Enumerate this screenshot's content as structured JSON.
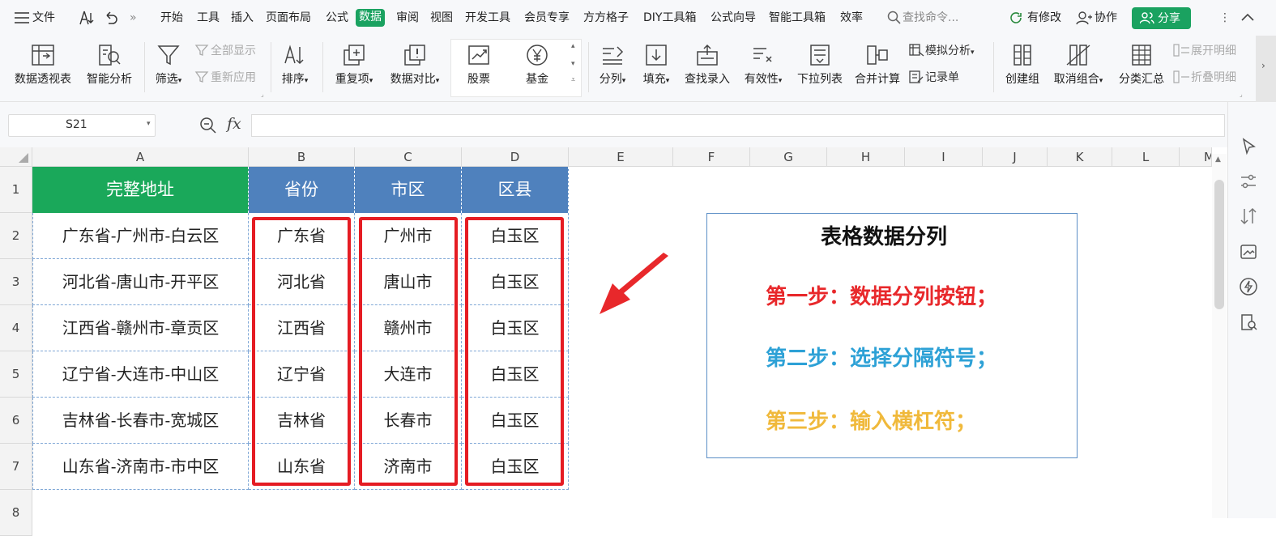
{
  "menu": {
    "file": "文件",
    "tabs": [
      "开始",
      "工具",
      "插入",
      "页面布局",
      "公式",
      "数据",
      "审阅",
      "视图",
      "开发工具",
      "会员专享",
      "方方格子",
      "DIY工具箱",
      "公式向导",
      "智能工具箱",
      "效率"
    ],
    "active_tab": "数据",
    "search_placeholder": "查找命令...",
    "modified": "有修改",
    "collab": "协作",
    "share": "分享"
  },
  "ribbon": {
    "pivot": "数据透视表",
    "smart": "智能分析",
    "filter": "筛选",
    "show_all": "全部显示",
    "reapply": "重新应用",
    "sort": "排序",
    "dup": "重复项",
    "compare": "数据对比",
    "stock": "股票",
    "fund": "基金",
    "split": "分列",
    "fill": "填充",
    "lookup": "查找录入",
    "valid": "有效性",
    "dropdown": "下拉列表",
    "merge_calc": "合并计算",
    "simulate": "模拟分析",
    "record": "记录单",
    "group": "创建组",
    "ungroup": "取消组合",
    "subtotal": "分类汇总",
    "expand": "展开明细",
    "collapse": "折叠明细"
  },
  "formula_bar": {
    "name_box": "S21",
    "fx": "fx",
    "content": ""
  },
  "columns": [
    "A",
    "B",
    "C",
    "D",
    "E",
    "F",
    "G",
    "H",
    "I",
    "J",
    "K",
    "L",
    "M"
  ],
  "rows": [
    "1",
    "2",
    "3",
    "4",
    "5",
    "6",
    "7",
    "8"
  ],
  "table": {
    "headers": [
      "完整地址",
      "省份",
      "市区",
      "区县"
    ],
    "data": [
      [
        "广东省-广州市-白云区",
        "广东省",
        "广州市",
        "白玉区"
      ],
      [
        "河北省-唐山市-开平区",
        "河北省",
        "唐山市",
        "白玉区"
      ],
      [
        "江西省-赣州市-章贡区",
        "江西省",
        "赣州市",
        "白玉区"
      ],
      [
        "辽宁省-大连市-中山区",
        "辽宁省",
        "大连市",
        "白玉区"
      ],
      [
        "吉林省-长春市-宽城区",
        "吉林省",
        "长春市",
        "白玉区"
      ],
      [
        "山东省-济南市-市中区",
        "山东省",
        "济南市",
        "白玉区"
      ]
    ]
  },
  "note": {
    "title": "表格数据分列",
    "step1": "第一步：数据分列按钮；",
    "step2": "第二步：选择分隔符号；",
    "step3": "第三步：输入横杠符；"
  },
  "colors": {
    "header_green": "#1aa85a",
    "header_blue": "#4f81bd",
    "red": "#e51c23",
    "step1": "#e8282b",
    "step2": "#2da1d6",
    "step3": "#f0b93b",
    "share_green": "#1aa260"
  }
}
